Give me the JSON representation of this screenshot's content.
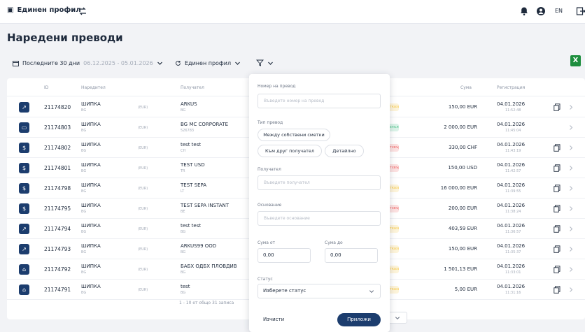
{
  "topbar": {
    "profile_label": "Единен профил",
    "language": "EN"
  },
  "page_title": "Наредени преводи",
  "filters": {
    "period_label": "Последните 30 дни",
    "period_range": "06.12.2025 - 05.01.2026",
    "profile_label": "Единен профил"
  },
  "table": {
    "columns": {
      "id": "ID",
      "payer": "Наредител",
      "recipient": "Получател",
      "amount": "Сума",
      "registered": "Регистрация"
    },
    "rows": [
      {
        "icon": "transfer-icon",
        "id": "21174820",
        "payer": "ШИПКА",
        "payer_sub": "BG",
        "iban": "(EUR)",
        "recipient": "ARKUS",
        "recipient_sub": "BG",
        "status": "Отказан",
        "status_color": "#f7c948",
        "amount": "150,00 EUR",
        "date": "04.01.2026",
        "time": "11:52:48",
        "copy": true
      },
      {
        "icon": "card-icon",
        "id": "21174803",
        "payer": "ШИПКА",
        "payer_sub": "BG",
        "iban": "(EUR)",
        "recipient": "BG MC CORPORATE",
        "recipient_sub": "526783",
        "status": "Изпълнен",
        "status_color": "#4cc38a",
        "amount": "2 000,00 EUR",
        "date": "04.01.2026",
        "time": "11:45:04",
        "copy": false
      },
      {
        "icon": "currency-icon",
        "id": "21174802",
        "payer": "ШИПКА",
        "payer_sub": "BG",
        "iban": "(EUR)",
        "recipient": "test test",
        "recipient_sub": "CH",
        "status": "Отхвърлен",
        "status_color": "#f06a6a",
        "amount": "330,00 CHF",
        "date": "04.01.2026",
        "time": "11:43:19",
        "copy": true
      },
      {
        "icon": "currency-icon",
        "id": "21174801",
        "payer": "ШИПКА",
        "payer_sub": "BG",
        "iban": "(EUR)",
        "recipient": "TEST USD",
        "recipient_sub": "TR",
        "status": "Отхвърлен",
        "status_color": "#f06a6a",
        "amount": "150,00 USD",
        "date": "04.01.2026",
        "time": "11:42:57",
        "copy": true
      },
      {
        "icon": "currency-icon",
        "id": "21174798",
        "payer": "ШИПКА",
        "payer_sub": "BG",
        "iban": "(EUR)",
        "recipient": "TEST SEPA",
        "recipient_sub": "LT",
        "status": "Отказан",
        "status_color": "#f7c948",
        "amount": "16 000,00 EUR",
        "date": "04.01.2026",
        "time": "11:39:55",
        "copy": true
      },
      {
        "icon": "currency-icon",
        "id": "21174795",
        "payer": "ШИПКА",
        "payer_sub": "BG",
        "iban": "(EUR)",
        "recipient": "TEST SEPA INSTANT",
        "recipient_sub": "BE",
        "status": "Отхвърлен",
        "status_color": "#f06a6a",
        "amount": "200,00 EUR",
        "date": "04.01.2026",
        "time": "11:38:24",
        "copy": true
      },
      {
        "icon": "transfer-icon",
        "id": "21174794",
        "payer": "ШИПКА",
        "payer_sub": "BG",
        "iban": "(EUR)",
        "recipient": "test test",
        "recipient_sub": "BG",
        "status": "Отказан",
        "status_color": "#f7c948",
        "amount": "403,59 EUR",
        "date": "04.01.2026",
        "time": "11:36:57",
        "copy": true
      },
      {
        "icon": "transfer-icon",
        "id": "21174793",
        "payer": "ШИПКА",
        "payer_sub": "BG",
        "iban": "(EUR)",
        "recipient": "ARKUS99 OOD",
        "recipient_sub": "BG",
        "status": "Отказан",
        "status_color": "#f7c948",
        "amount": "150,00 EUR",
        "date": "04.01.2026",
        "time": "11:35:37",
        "copy": true
      },
      {
        "icon": "bank-icon",
        "id": "21174792",
        "payer": "ШИПКА",
        "payer_sub": "BG",
        "iban": "(EUR)",
        "recipient": "БАБХ ОДБХ ПЛОВДИВ",
        "recipient_sub": "BG",
        "status": "Отказан",
        "status_color": "#f7c948",
        "amount": "1 501,13 EUR",
        "date": "04.01.2026",
        "time": "11:33:01",
        "copy": true
      },
      {
        "icon": "bank-icon",
        "id": "21174791",
        "payer": "ШИПКА",
        "payer_sub": "BG",
        "iban": "(EUR)",
        "recipient": "test",
        "recipient_sub": "BG",
        "status": "Отказан",
        "status_color": "#f7c948",
        "amount": "5,00 EUR",
        "date": "04.01.2026",
        "time": "11:31:16",
        "copy": true
      }
    ],
    "footer": "1 - 10 от общо 31 записа"
  },
  "popover": {
    "transfer_number_label": "Номер на превод",
    "transfer_number_placeholder": "Въведете номер на превод",
    "type_label": "Тип превод",
    "type_own": "Между собствени сметки",
    "type_other": "Към друг получател",
    "type_detailed": "Детайлно",
    "recipient_label": "Получател",
    "recipient_placeholder": "Въведете получател",
    "reason_label": "Основание",
    "reason_placeholder": "Въведете основание",
    "amount_from_label": "Сума от",
    "amount_from_value": "0,00",
    "amount_to_label": "Сума до",
    "amount_to_value": "0,00",
    "status_label": "Статус",
    "status_placeholder": "Изберете статус",
    "clear_label": "Изчисти",
    "apply_label": "Приложи"
  },
  "colors": {
    "primary": "#1c3d6e",
    "excel": "#1e8e3e"
  }
}
